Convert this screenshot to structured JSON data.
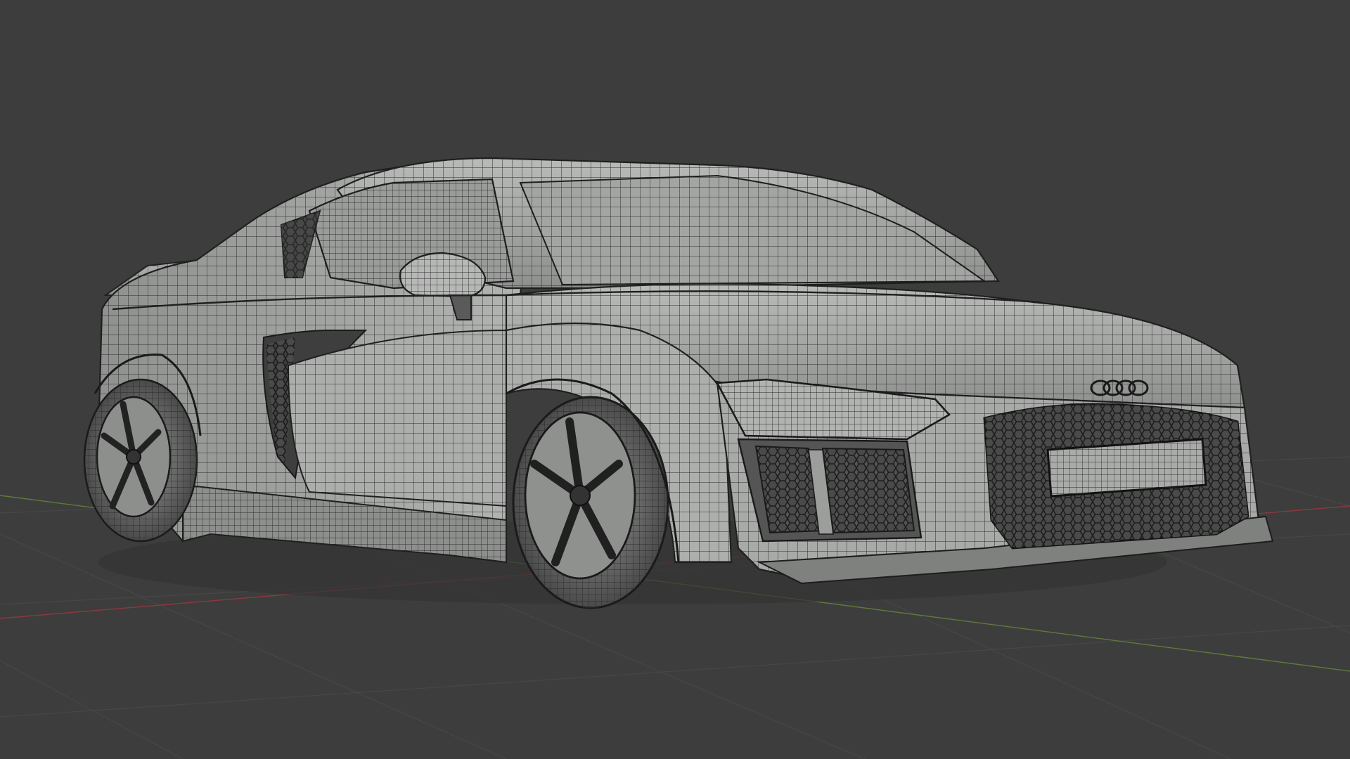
{
  "viewport": {
    "mode": "wireframe-solid",
    "background_color": "#3d3d3d",
    "grid_color": "#474747",
    "x_axis_color": "#8a3a3f",
    "y_axis_color": "#5f7a3a",
    "mesh_fill_color": "#a7a9a7",
    "mesh_wire_color": "#2a2a2a",
    "subject": "car-wireframe-model"
  },
  "car": {
    "badge_icon": "four-rings-logo-icon"
  }
}
